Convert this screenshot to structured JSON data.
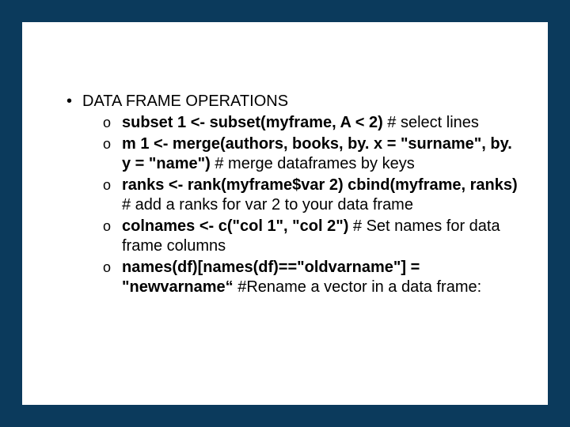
{
  "heading": "DATA FRAME OPERATIONS",
  "items": [
    {
      "code": "subset 1 <- subset(myframe, A < 2)",
      "comment": " # select lines"
    },
    {
      "code": "m 1 <- merge(authors, books, by. x = \"surname\", by. y = \"name\")",
      "comment": " # merge dataframes by keys"
    },
    {
      "code": "ranks <- rank(myframe$var 2) cbind(myframe, ranks)",
      "comment": " # add a ranks for var 2 to your data frame"
    },
    {
      "code": "colnames <- c(\"col 1\", \"col 2\")",
      "comment": " # Set names for data frame columns"
    },
    {
      "code": "names(df)[names(df)==\"oldvarname\"] = \"newvarname“",
      "comment": " #Rename a vector in a data frame:"
    }
  ]
}
